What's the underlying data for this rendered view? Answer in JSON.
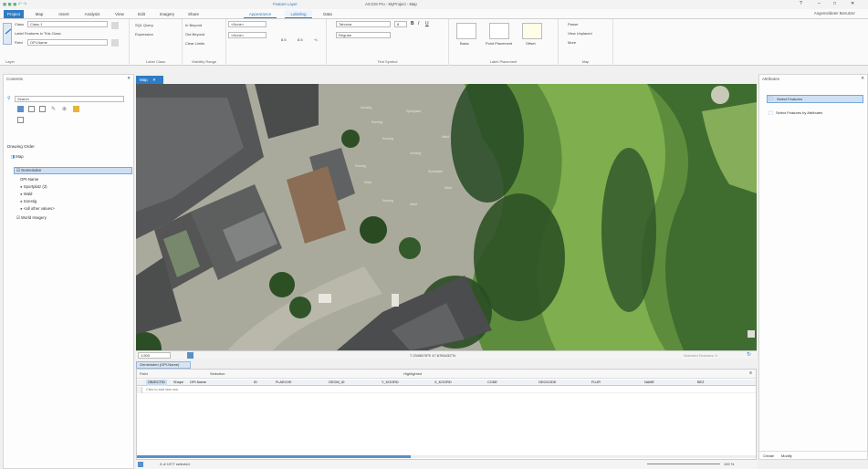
{
  "titlebar": {
    "context_label": "Feature Layer",
    "doc_title": "ArcGIS Pro - MyProject - Map",
    "user": "Angemeldeter Benutzer"
  },
  "tabs": [
    {
      "label": "Project",
      "state": "active"
    },
    {
      "label": "Map",
      "state": ""
    },
    {
      "label": "Insert",
      "state": ""
    },
    {
      "label": "Analysis",
      "state": ""
    },
    {
      "label": "View",
      "state": ""
    },
    {
      "label": "Edit",
      "state": ""
    },
    {
      "label": "Imagery",
      "state": ""
    },
    {
      "label": "Share",
      "state": ""
    },
    {
      "label": "Appearance",
      "state": "ctx"
    },
    {
      "label": "Labeling",
      "state": "ctx"
    },
    {
      "label": "Data",
      "state": ""
    }
  ],
  "ribbon": {
    "layer_group": {
      "label": "Layer",
      "class_label": "Class",
      "class_value": "Class 1",
      "field_label": "Field",
      "field_value": "OPI-Name",
      "toggle_label": "Label Features in This Class"
    },
    "label_class_group": {
      "label": "Label Class",
      "sql": "SQL Query",
      "expression": "Expression"
    },
    "visibility_group": {
      "label": "Visibility Range",
      "out_beyond": "In Beyond",
      "in_beyond": "Out Beyond",
      "clear": "Clear Limits",
      "scale1": "<None>",
      "scale2": "<None>"
    },
    "text_symbol_group": {
      "label": "Text Symbol",
      "font": "Tahoma",
      "size": "8",
      "style": "Regular",
      "b1": "8.5",
      "b2": "8.5",
      "b3": "+/-"
    },
    "placement_group": {
      "label": "Label Placement",
      "p1": "Basic",
      "p2": "Point Placement",
      "p3": "Offset"
    },
    "map_group": {
      "label": "Map",
      "pause": "Pause",
      "view_unplaced": "View Unplaced",
      "more": "More"
    }
  },
  "contents": {
    "title": "Contents",
    "search_placeholder": "Search",
    "drawing_order": "Drawing Order",
    "items": [
      {
        "label": "Map"
      },
      {
        "label": "Gemeinden"
      },
      {
        "label": "OPI-Name"
      },
      {
        "label": "Sportplatz (3)"
      },
      {
        "label": "Wald"
      },
      {
        "label": "Sonstig"
      },
      {
        "label": "<all other values>"
      },
      {
        "label": "World Imagery"
      }
    ]
  },
  "map": {
    "tab_label": "Map",
    "labels": [
      {
        "text": "Sonstig"
      },
      {
        "text": "Sportplatz"
      },
      {
        "text": "Wald"
      },
      {
        "text": "Sonstig"
      },
      {
        "text": "Sportplatz"
      },
      {
        "text": "Wald"
      },
      {
        "text": "Sonstig"
      },
      {
        "text": "Sonstig"
      },
      {
        "text": "Sonstig"
      },
      {
        "text": "Wald"
      },
      {
        "text": "Sonstig"
      },
      {
        "text": "Wald"
      }
    ],
    "scale": "1:500",
    "coords": "7.2345678°E 47.8765432°N",
    "selected": "Selected Features: 0"
  },
  "attribute_table": {
    "title": "Gemeinden (OPI-Name)",
    "field_label": "Field",
    "selection_label": "Selection",
    "highlighted_label": "Highlighted",
    "columns": [
      "OBJECTID",
      "Shape",
      "OPI-Name",
      "ID",
      "FLAECHE",
      "GEOM_ID",
      "Y_KOORD",
      "X_KOORD",
      "CODE",
      "GEOCODE",
      "FLUR",
      "NAME",
      "BEZ"
    ],
    "row1": "Click to add new row",
    "footer": "0 of 1977 selected",
    "zoom": "100 %"
  },
  "right_panel": {
    "title": "Attributes",
    "item1": "Select Features",
    "item2": "Select Features by Attributes",
    "bottom_tab1": "Create",
    "bottom_tab2": "Modify"
  }
}
